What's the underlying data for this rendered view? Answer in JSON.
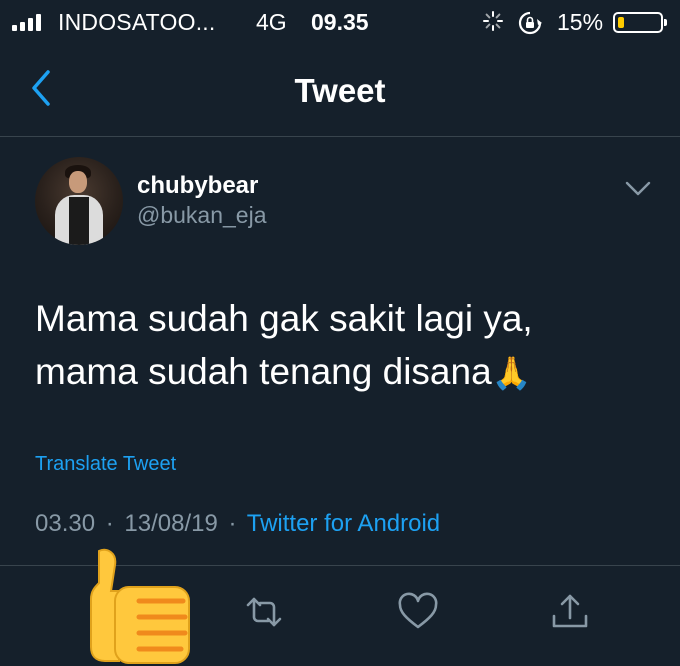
{
  "status_bar": {
    "carrier": "INDOSATOO...",
    "network": "4G",
    "time": "09.35",
    "battery_percent": "15%",
    "battery_level": 0.15,
    "battery_color": "#ffcc00"
  },
  "header": {
    "title": "Tweet"
  },
  "tweet": {
    "display_name": "chubybear",
    "handle": "@bukan_eja",
    "text_line1": "Mama sudah gak sakit lagi ya,",
    "text_line2": "mama sudah tenang disana",
    "emoji": "🙏",
    "translate_label": "Translate Tweet",
    "time": "03.30",
    "date": "13/08/19",
    "separator": "·",
    "source": "Twitter for Android"
  },
  "actions": [
    "reply-icon",
    "retweet-icon",
    "like-icon",
    "share-icon"
  ],
  "colors": {
    "background": "#15202b",
    "accent": "#1da1f2",
    "secondary_text": "#8899a6",
    "divider": "#38444d"
  }
}
